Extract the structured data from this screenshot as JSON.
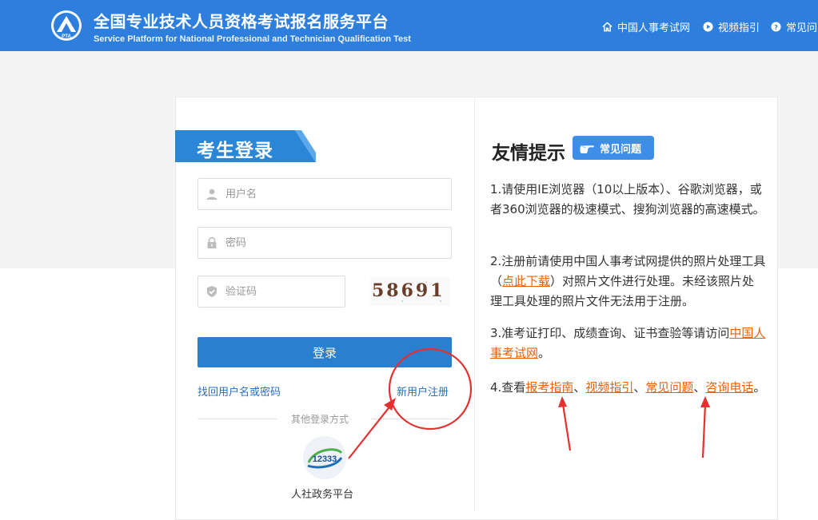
{
  "header": {
    "title_cn": "全国专业技术人员资格考试报名服务平台",
    "title_en": "Service Platform for National Professional and Technician Qualification Test",
    "nav": [
      {
        "label": "中国人事考试网",
        "icon": "home-icon"
      },
      {
        "label": "视频指引",
        "icon": "play-circle-icon"
      },
      {
        "label": "常见问",
        "icon": "question-circle-icon"
      }
    ]
  },
  "login": {
    "title": "考生登录",
    "username_placeholder": "用户名",
    "password_placeholder": "密码",
    "captcha_placeholder": "验证码",
    "captcha_text": "58691",
    "submit_label": "登录",
    "forgot_link": "找回用户名或密码",
    "register_link": "新用户注册",
    "other_methods_label": "其他登录方式",
    "app_icon_text": "12333",
    "app_label": "人社政务平台"
  },
  "tips": {
    "title": "友情提示",
    "faq_badge": "常见问题",
    "tip1": "1.请使用IE浏览器（10以上版本）、谷歌浏览器，或者360浏览器的极速模式、搜狗浏览器的高速模式。",
    "tip2_a": "2.注册前请使用中国人事考试网提供的照片处理工具（",
    "tip2_link": "点此下载",
    "tip2_b": "）对照片文件进行处理。未经该照片处理工具处理的照片文件无法用于注册。",
    "tip3_a": "3.准考证打印、成绩查询、证书查验等请访问",
    "tip3_link": "中国人事考试网",
    "tip3_b": "。",
    "tip4_a": "4.查看",
    "tip4_link1": "报考指南",
    "tip4_sep1": "、",
    "tip4_link2": "视频指引",
    "tip4_sep2": "、",
    "tip4_link3": "常见问题",
    "tip4_sep3": "、",
    "tip4_link4": "咨询电话",
    "tip4_b": "。"
  },
  "colors": {
    "header_bg": "#2e7fdd",
    "ribbon": "#2a86d6",
    "button": "#2a7fcf",
    "link_orange": "#e8620c",
    "annotation_red": "#e53030"
  }
}
